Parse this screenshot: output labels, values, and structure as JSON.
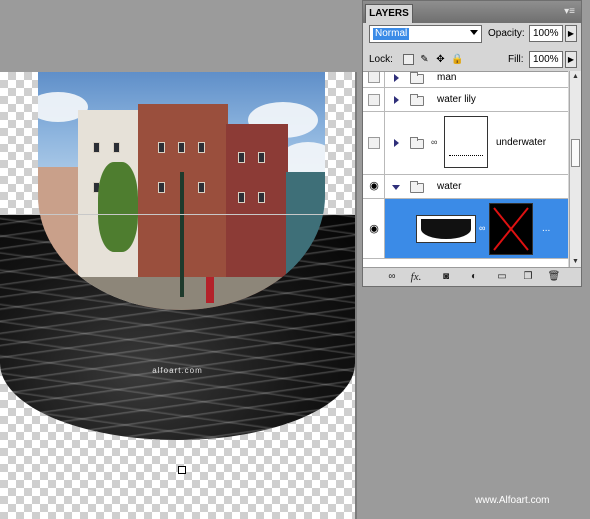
{
  "canvas": {
    "watermark": "alfoart.com"
  },
  "layers_panel": {
    "tab_label": "LAYERS",
    "menu_icon": "panel-menu-icon",
    "blend_mode": "Normal",
    "opacity_label": "Opacity:",
    "opacity_value": "100%",
    "lock_label": "Lock:",
    "fill_label": "Fill:",
    "fill_value": "100%",
    "layers": [
      {
        "name": "man",
        "visible": false,
        "type": "group",
        "expanded": false
      },
      {
        "name": "water lily",
        "visible": false,
        "type": "group",
        "expanded": false
      },
      {
        "name": "underwater",
        "visible": false,
        "type": "group-with-mask",
        "expanded": false
      },
      {
        "name": "water",
        "visible": true,
        "type": "group",
        "expanded": true
      },
      {
        "name": "...",
        "visible": true,
        "type": "layer-with-mask",
        "selected": true
      }
    ],
    "bottom_icons": [
      "link-layers-icon",
      "fx-icon",
      "add-mask-icon",
      "adjustment-layer-icon",
      "new-group-icon",
      "new-layer-icon",
      "trash-icon"
    ],
    "fx_label": "fx."
  },
  "footer": {
    "watermark": "www.Alfoart.com"
  }
}
